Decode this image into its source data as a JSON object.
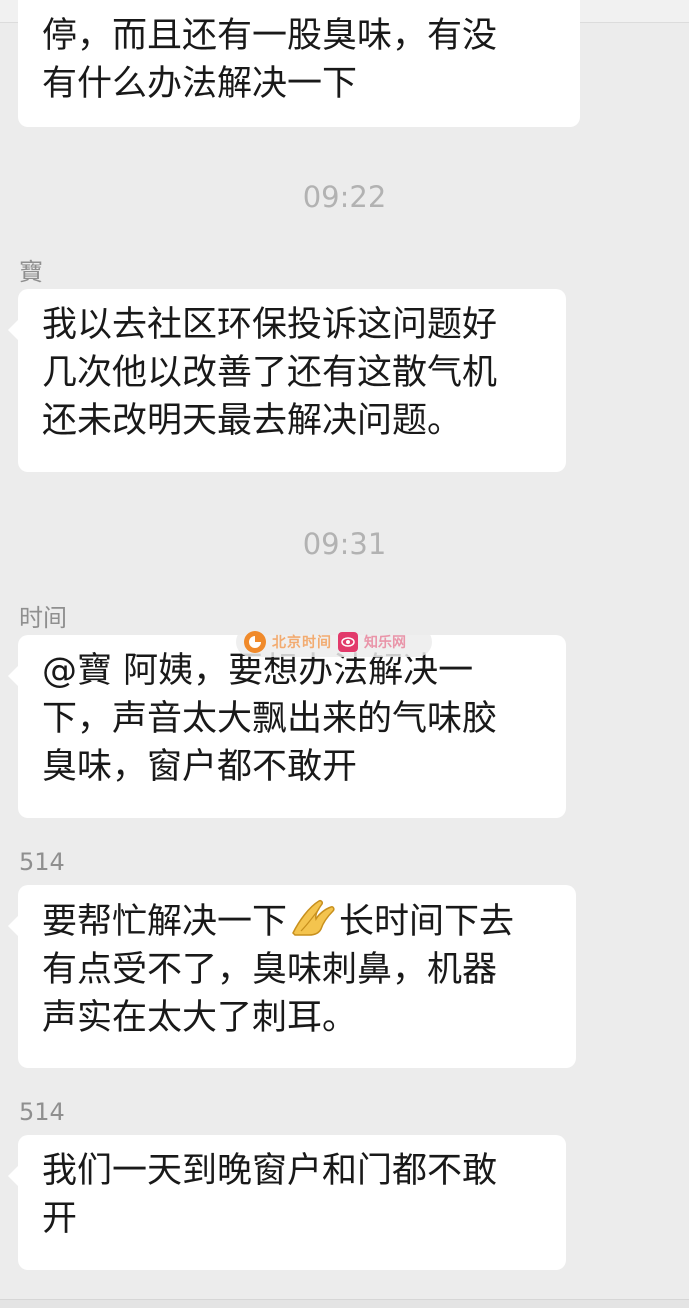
{
  "messages": [
    {
      "lines": [
        "停，而且还有一股臭味，有没",
        "有什么办法解决一下"
      ]
    },
    {
      "time": "09:22",
      "sender": "寶",
      "lines": [
        "我以去社区环保投诉这问题好",
        "几次他以改善了还有这散气机",
        "还未改明天最去解决问题。"
      ]
    },
    {
      "time": "09:31",
      "sender": "时间",
      "lines": [
        "@寶 阿姨，要想办法解决一",
        "下，声音太大飘出来的气味胶",
        "臭味，窗户都不敢开"
      ]
    },
    {
      "sender": "514",
      "lines_a": "要帮忙解决一下",
      "emoji": "folded-hands-emoji",
      "lines_b": "长时间下去",
      "lines": [
        "有点受不了，臭味刺鼻，机器",
        "声实在太大了刺耳。"
      ]
    },
    {
      "sender": "514",
      "lines": [
        "我们一天到晚窗户和门都不敢",
        "开"
      ]
    }
  ],
  "watermark": {
    "left_text": "北京时间",
    "right_text": "知乐网"
  },
  "colors": {
    "background": "#ececec",
    "bubble": "#ffffff",
    "time": "#b2b2b2",
    "sender": "#8f8f8f",
    "text": "#191919"
  }
}
